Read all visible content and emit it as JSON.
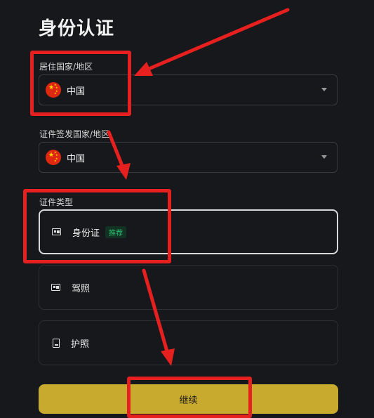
{
  "page": {
    "title": "身份认证"
  },
  "residence": {
    "label": "居住国家/地区",
    "value": "中国",
    "flag_icon": "china-flag-icon"
  },
  "issuing": {
    "label": "证件签发国家/地区",
    "value": "中国",
    "flag_icon": "china-flag-icon"
  },
  "doc_type": {
    "label": "证件类型",
    "options": [
      {
        "label": "身份证",
        "badge": "推荐",
        "icon": "id-card-icon",
        "selected": true
      },
      {
        "label": "驾照",
        "icon": "driver-license-icon",
        "selected": false
      },
      {
        "label": "护照",
        "icon": "passport-icon",
        "selected": false
      }
    ]
  },
  "continue_label": "继续",
  "colors": {
    "accent": "#c8aa2e",
    "annotation": "#e5201f",
    "background": "#17181b",
    "badge_text": "#2fbf71"
  }
}
